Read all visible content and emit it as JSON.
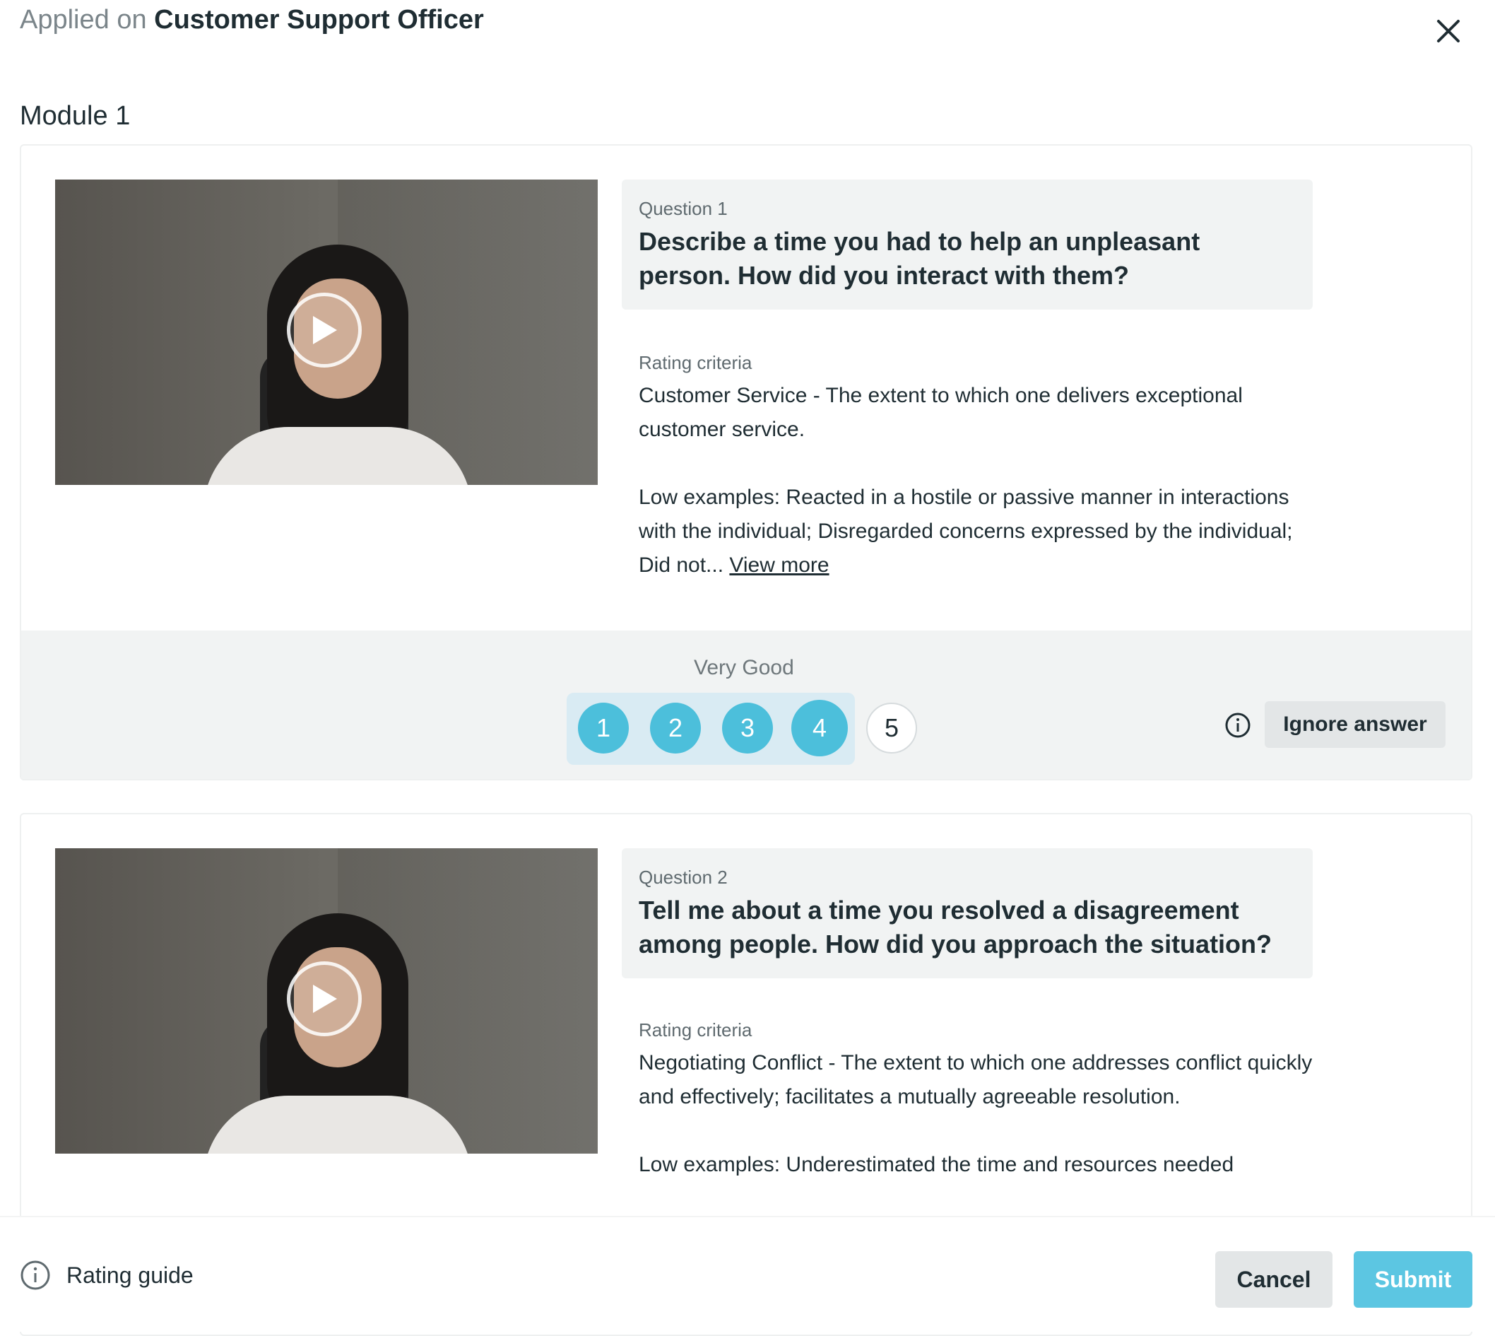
{
  "header": {
    "prefix": "Applied on",
    "role": "Customer Support Officer",
    "close_icon": "close-icon"
  },
  "module": {
    "title": "Module 1"
  },
  "questions": [
    {
      "label": "Question 1",
      "text": "Describe a time you had to help an unpleasant person. How did you interact with them?",
      "criteria_label": "Rating criteria",
      "criteria_text": "Customer Service - The extent to which one delivers exceptional customer service.",
      "low_examples": "Low examples: Reacted in a hostile or passive manner in interactions with the individual; Disregarded concerns expressed by the individual; Did not...",
      "view_more": "View more",
      "rating": {
        "label": "Very Good",
        "scale": [
          "1",
          "2",
          "3",
          "4",
          "5"
        ],
        "selected": 4,
        "ignore_label": "Ignore answer"
      }
    },
    {
      "label": "Question 2",
      "text": "Tell me about a time you resolved a disagreement among people. How did you approach the situation?",
      "criteria_label": "Rating criteria",
      "criteria_text": "Negotiating Conflict - The extent to which one addresses conflict quickly and effectively; facilitates a mutually agreeable resolution.",
      "low_examples": "Low examples: Underestimated the time and resources needed"
    }
  ],
  "footer": {
    "guide_label": "Rating guide",
    "cancel_label": "Cancel",
    "submit_label": "Submit"
  },
  "colors": {
    "accent": "#4cbfdb",
    "submit": "#5cc6e2",
    "panel": "#f1f3f3"
  }
}
